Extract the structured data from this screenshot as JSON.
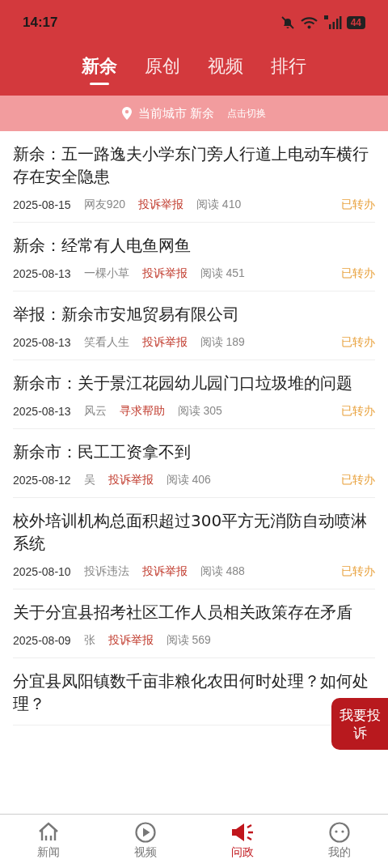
{
  "status_bar": {
    "time": "14:17",
    "battery": "44"
  },
  "tabs": [
    {
      "label": "新余",
      "selected": true
    },
    {
      "label": "原创",
      "selected": false
    },
    {
      "label": "视频",
      "selected": false
    },
    {
      "label": "排行",
      "selected": false
    }
  ],
  "city_bar": {
    "label": "当前城市 新余",
    "action": "点击切换"
  },
  "posts": [
    {
      "title": "新余：五一路逸夫小学东门旁人行道上电动车横行存在安全隐患",
      "meta": {
        "date": "2025-08-15",
        "author": "网友920",
        "category": "投诉举报",
        "reads": "阅读 410",
        "status": "已转办"
      }
    },
    {
      "title": "新余：经常有人电鱼网鱼",
      "meta": {
        "date": "2025-08-13",
        "author": "一棵小草",
        "category": "投诉举报",
        "reads": "阅读 451",
        "status": "已转办"
      }
    },
    {
      "title": "举报：新余市安旭贸易有限公司",
      "meta": {
        "date": "2025-08-13",
        "author": "笑看人生",
        "category": "投诉举报",
        "reads": "阅读 189",
        "status": "已转办"
      }
    },
    {
      "title": "新余市：关于景江花园幼儿园门口垃圾堆的问题",
      "meta": {
        "date": "2025-08-13",
        "author": "风云",
        "category": "寻求帮助",
        "reads": "阅读 305",
        "status": "已转办"
      }
    },
    {
      "title": "新余市：民工工资拿不到",
      "meta": {
        "date": "2025-08-12",
        "author": "吴",
        "category": "投诉举报",
        "reads": "阅读 406",
        "status": "已转办"
      }
    },
    {
      "title": "校外培训机构总面积超过300平方无消防自动喷淋系统",
      "meta": {
        "date": "2025-08-10",
        "author": "投诉违法",
        "category": "投诉举报",
        "reads": "阅读 488",
        "status": "已转办"
      }
    },
    {
      "title": "关于分宜县招考社区工作人员相关政策存在矛盾",
      "meta": {
        "date": "2025-08-09",
        "author": "张",
        "category": "投诉举报",
        "reads": "阅读 569"
      }
    },
    {
      "title": "分宜县凤阳镇数千亩非粮化农田何时处理？如何处理？"
    }
  ],
  "float_button": "我要投诉",
  "bottom_nav": [
    {
      "label": "新闻",
      "kind": "house",
      "selected": false
    },
    {
      "label": "视频",
      "kind": "play",
      "selected": false
    },
    {
      "label": "问政",
      "kind": "speaker",
      "selected": true
    },
    {
      "label": "我的",
      "kind": "face",
      "selected": false
    }
  ]
}
